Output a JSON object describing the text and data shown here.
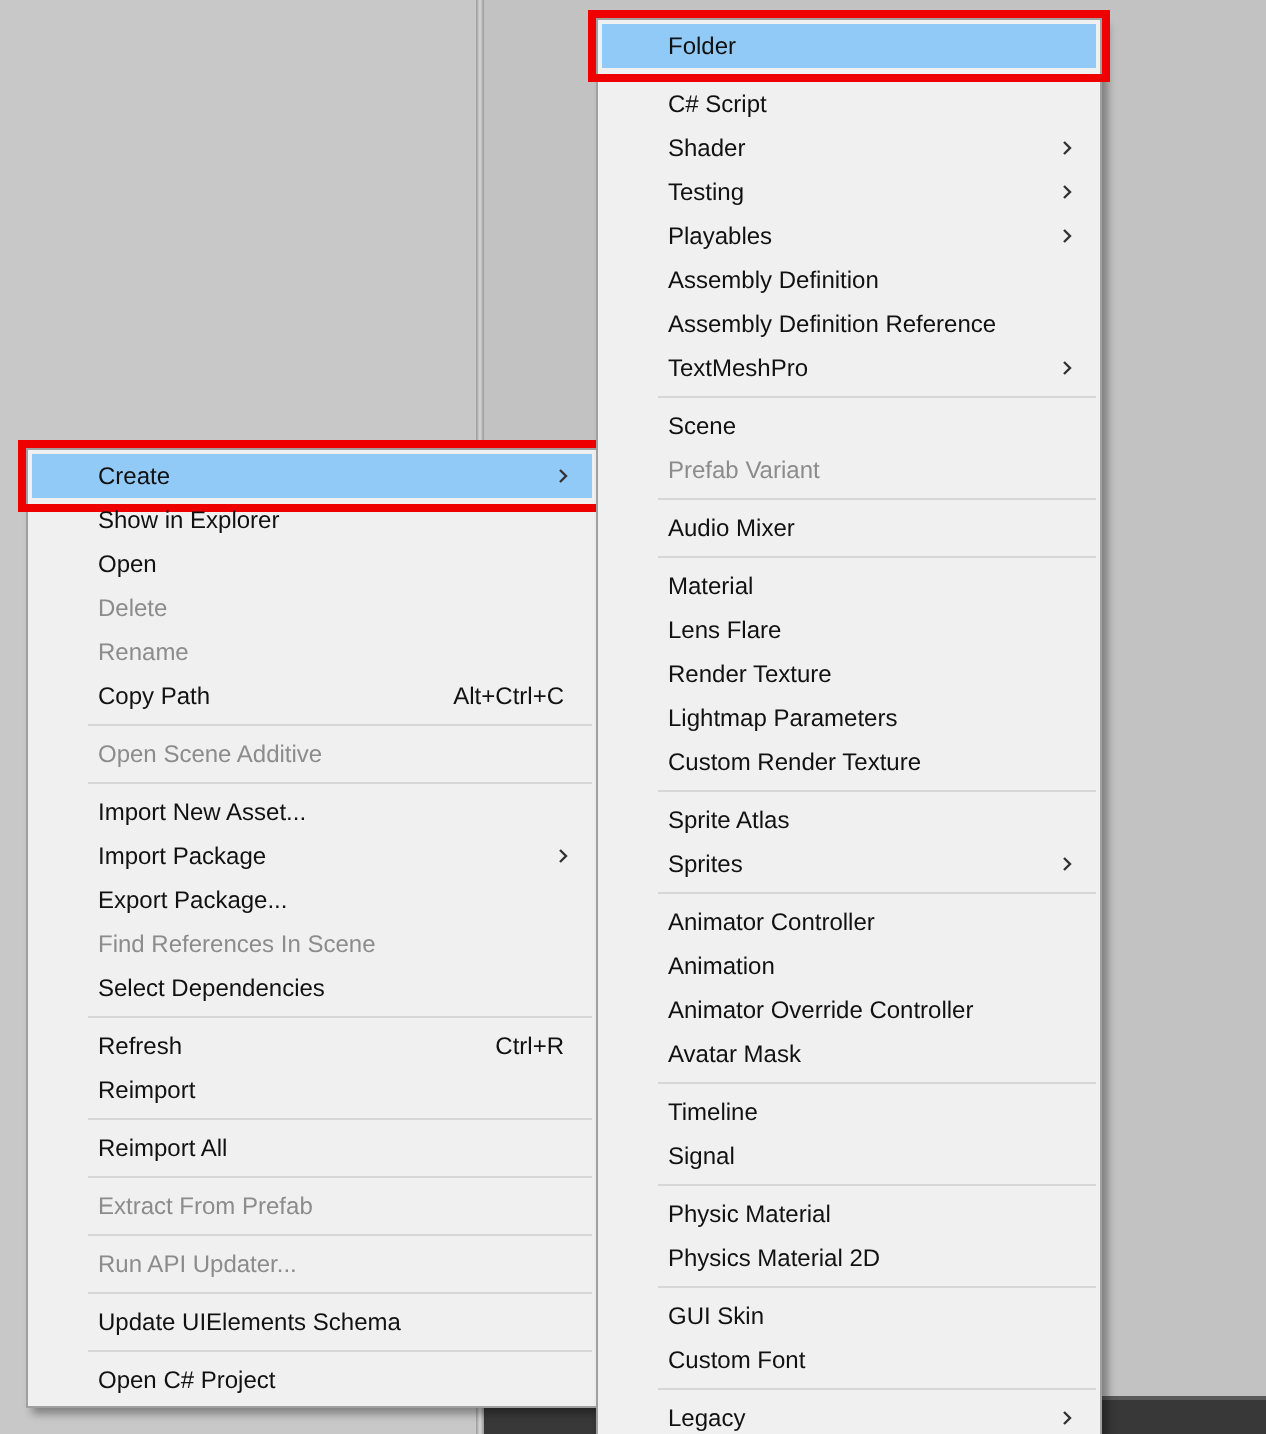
{
  "context_menu": {
    "items": [
      {
        "kind": "item",
        "label": "Create",
        "submenu": true,
        "disabled": false,
        "selected": true
      },
      {
        "kind": "item",
        "label": "Show in Explorer",
        "disabled": false,
        "selected": false
      },
      {
        "kind": "item",
        "label": "Open",
        "disabled": false,
        "selected": false
      },
      {
        "kind": "item",
        "label": "Delete",
        "disabled": true,
        "selected": false
      },
      {
        "kind": "item",
        "label": "Rename",
        "disabled": true,
        "selected": false
      },
      {
        "kind": "item",
        "label": "Copy Path",
        "shortcut": "Alt+Ctrl+C",
        "disabled": false,
        "selected": false
      },
      {
        "kind": "separator"
      },
      {
        "kind": "item",
        "label": "Open Scene Additive",
        "disabled": true,
        "selected": false
      },
      {
        "kind": "separator"
      },
      {
        "kind": "item",
        "label": "Import New Asset...",
        "disabled": false,
        "selected": false
      },
      {
        "kind": "item",
        "label": "Import Package",
        "submenu": true,
        "disabled": false,
        "selected": false
      },
      {
        "kind": "item",
        "label": "Export Package...",
        "disabled": false,
        "selected": false
      },
      {
        "kind": "item",
        "label": "Find References In Scene",
        "disabled": true,
        "selected": false
      },
      {
        "kind": "item",
        "label": "Select Dependencies",
        "disabled": false,
        "selected": false
      },
      {
        "kind": "separator"
      },
      {
        "kind": "item",
        "label": "Refresh",
        "shortcut": "Ctrl+R",
        "disabled": false,
        "selected": false
      },
      {
        "kind": "item",
        "label": "Reimport",
        "disabled": false,
        "selected": false
      },
      {
        "kind": "separator"
      },
      {
        "kind": "item",
        "label": "Reimport All",
        "disabled": false,
        "selected": false
      },
      {
        "kind": "separator"
      },
      {
        "kind": "item",
        "label": "Extract From Prefab",
        "disabled": true,
        "selected": false
      },
      {
        "kind": "separator"
      },
      {
        "kind": "item",
        "label": "Run API Updater...",
        "disabled": true,
        "selected": false
      },
      {
        "kind": "separator"
      },
      {
        "kind": "item",
        "label": "Update UIElements Schema",
        "disabled": false,
        "selected": false
      },
      {
        "kind": "separator"
      },
      {
        "kind": "item",
        "label": "Open C# Project",
        "disabled": false,
        "selected": false
      }
    ]
  },
  "create_submenu": {
    "items": [
      {
        "kind": "item",
        "label": "Folder",
        "disabled": false,
        "selected": true
      },
      {
        "kind": "separator"
      },
      {
        "kind": "item",
        "label": "C# Script",
        "disabled": false,
        "selected": false
      },
      {
        "kind": "item",
        "label": "Shader",
        "submenu": true,
        "disabled": false,
        "selected": false
      },
      {
        "kind": "item",
        "label": "Testing",
        "submenu": true,
        "disabled": false,
        "selected": false
      },
      {
        "kind": "item",
        "label": "Playables",
        "submenu": true,
        "disabled": false,
        "selected": false
      },
      {
        "kind": "item",
        "label": "Assembly Definition",
        "disabled": false,
        "selected": false
      },
      {
        "kind": "item",
        "label": "Assembly Definition Reference",
        "disabled": false,
        "selected": false
      },
      {
        "kind": "item",
        "label": "TextMeshPro",
        "submenu": true,
        "disabled": false,
        "selected": false
      },
      {
        "kind": "separator"
      },
      {
        "kind": "item",
        "label": "Scene",
        "disabled": false,
        "selected": false
      },
      {
        "kind": "item",
        "label": "Prefab Variant",
        "disabled": true,
        "selected": false
      },
      {
        "kind": "separator"
      },
      {
        "kind": "item",
        "label": "Audio Mixer",
        "disabled": false,
        "selected": false
      },
      {
        "kind": "separator"
      },
      {
        "kind": "item",
        "label": "Material",
        "disabled": false,
        "selected": false
      },
      {
        "kind": "item",
        "label": "Lens Flare",
        "disabled": false,
        "selected": false
      },
      {
        "kind": "item",
        "label": "Render Texture",
        "disabled": false,
        "selected": false
      },
      {
        "kind": "item",
        "label": "Lightmap Parameters",
        "disabled": false,
        "selected": false
      },
      {
        "kind": "item",
        "label": "Custom Render Texture",
        "disabled": false,
        "selected": false
      },
      {
        "kind": "separator"
      },
      {
        "kind": "item",
        "label": "Sprite Atlas",
        "disabled": false,
        "selected": false
      },
      {
        "kind": "item",
        "label": "Sprites",
        "submenu": true,
        "disabled": false,
        "selected": false
      },
      {
        "kind": "separator"
      },
      {
        "kind": "item",
        "label": "Animator Controller",
        "disabled": false,
        "selected": false
      },
      {
        "kind": "item",
        "label": "Animation",
        "disabled": false,
        "selected": false
      },
      {
        "kind": "item",
        "label": "Animator Override Controller",
        "disabled": false,
        "selected": false
      },
      {
        "kind": "item",
        "label": "Avatar Mask",
        "disabled": false,
        "selected": false
      },
      {
        "kind": "separator"
      },
      {
        "kind": "item",
        "label": "Timeline",
        "disabled": false,
        "selected": false
      },
      {
        "kind": "item",
        "label": "Signal",
        "disabled": false,
        "selected": false
      },
      {
        "kind": "separator"
      },
      {
        "kind": "item",
        "label": "Physic Material",
        "disabled": false,
        "selected": false
      },
      {
        "kind": "item",
        "label": "Physics Material 2D",
        "disabled": false,
        "selected": false
      },
      {
        "kind": "separator"
      },
      {
        "kind": "item",
        "label": "GUI Skin",
        "disabled": false,
        "selected": false
      },
      {
        "kind": "item",
        "label": "Custom Font",
        "disabled": false,
        "selected": false
      },
      {
        "kind": "separator"
      },
      {
        "kind": "item",
        "label": "Legacy",
        "submenu": true,
        "disabled": false,
        "selected": false
      }
    ]
  }
}
